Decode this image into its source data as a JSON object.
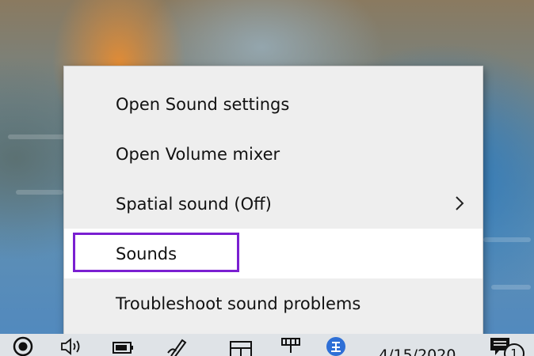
{
  "context_menu": {
    "items": [
      {
        "label": "Open Sound settings",
        "has_submenu": false,
        "highlighted": false
      },
      {
        "label": "Open Volume mixer",
        "has_submenu": false,
        "highlighted": false
      },
      {
        "label": "Spatial sound (Off)",
        "has_submenu": true,
        "highlighted": false
      },
      {
        "label": "Sounds",
        "has_submenu": false,
        "highlighted": true
      },
      {
        "label": "Troubleshoot sound problems",
        "has_submenu": false,
        "highlighted": false
      }
    ],
    "annotation_color": "#7a1fd1"
  },
  "taskbar": {
    "icons": [
      "record-icon",
      "volume-icon",
      "battery-icon",
      "pen-icon",
      "touch-keyboard-icon",
      "network-icon",
      "ime-icon"
    ],
    "date_text": "4/15/2020",
    "notification_count": "1"
  },
  "colors": {
    "menu_background": "#eeeeee",
    "menu_hover": "#ffffff",
    "taskbar_background": "#dfe3e7"
  }
}
